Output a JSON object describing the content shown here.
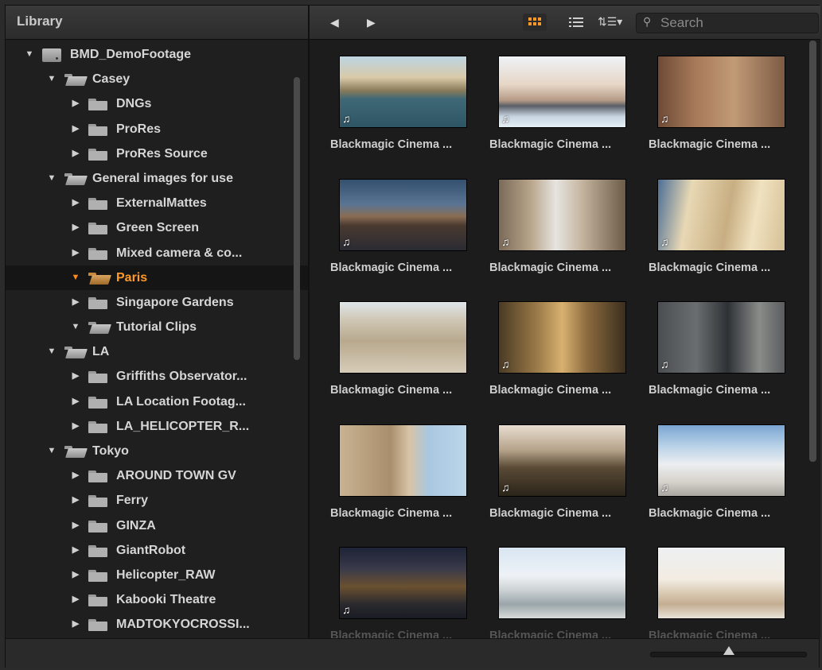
{
  "sidebar": {
    "title": "Library",
    "tree": [
      {
        "label": "BMD_DemoFootage",
        "icon": "drive-icon",
        "expanded": true,
        "level": 0
      },
      {
        "label": "Casey",
        "icon": "folder-open-icon",
        "expanded": true,
        "level": 1
      },
      {
        "label": "DNGs",
        "icon": "folder-icon",
        "expanded": false,
        "level": 2
      },
      {
        "label": "ProRes",
        "icon": "folder-icon",
        "expanded": false,
        "level": 2
      },
      {
        "label": "ProRes Source",
        "icon": "folder-icon",
        "expanded": false,
        "level": 2
      },
      {
        "label": "General images for use",
        "icon": "folder-open-icon",
        "expanded": true,
        "level": 1
      },
      {
        "label": "ExternalMattes",
        "icon": "folder-icon",
        "expanded": false,
        "level": 2
      },
      {
        "label": "Green Screen",
        "icon": "folder-icon",
        "expanded": false,
        "level": 2
      },
      {
        "label": "Mixed camera & co...",
        "icon": "folder-icon",
        "expanded": false,
        "level": 2
      },
      {
        "label": "Paris",
        "icon": "folder-open-icon",
        "expanded": true,
        "level": 2,
        "selected": true
      },
      {
        "label": "Singapore Gardens",
        "icon": "folder-icon",
        "expanded": false,
        "level": 2
      },
      {
        "label": "Tutorial Clips",
        "icon": "folder-open-icon",
        "expanded": true,
        "level": 2
      },
      {
        "label": "LA",
        "icon": "folder-open-icon",
        "expanded": true,
        "level": 1
      },
      {
        "label": "Griffiths Observator...",
        "icon": "folder-icon",
        "expanded": false,
        "level": 2
      },
      {
        "label": "LA Location Footag...",
        "icon": "folder-icon",
        "expanded": false,
        "level": 2
      },
      {
        "label": "LA_HELICOPTER_R...",
        "icon": "folder-icon",
        "expanded": false,
        "level": 2
      },
      {
        "label": "Tokyo",
        "icon": "folder-open-icon",
        "expanded": true,
        "level": 1
      },
      {
        "label": "AROUND TOWN GV",
        "icon": "folder-icon",
        "expanded": false,
        "level": 2
      },
      {
        "label": "Ferry",
        "icon": "folder-icon",
        "expanded": false,
        "level": 2
      },
      {
        "label": "GINZA",
        "icon": "folder-icon",
        "expanded": false,
        "level": 2
      },
      {
        "label": "GiantRobot",
        "icon": "folder-icon",
        "expanded": false,
        "level": 2
      },
      {
        "label": "Helicopter_RAW",
        "icon": "folder-icon",
        "expanded": false,
        "level": 2
      },
      {
        "label": "Kabooki Theatre",
        "icon": "folder-icon",
        "expanded": false,
        "level": 2
      },
      {
        "label": "MADTOKYOCROSSI...",
        "icon": "folder-icon",
        "expanded": false,
        "level": 2
      }
    ]
  },
  "toolbar": {
    "back_icon": "back-arrow-icon",
    "forward_icon": "forward-arrow-icon",
    "thumbnail_view_icon": "grid-view-icon",
    "list_view_icon": "list-view-icon",
    "sort_icon": "sort-menu-icon",
    "search_placeholder": "Search"
  },
  "clips": [
    {
      "label": "Blackmagic Cinema ...",
      "audio": true,
      "thumb": "linear-gradient(#bcd5e2 0%, #d9c9a8 30%, #8a7c5a 48%, #3f6876 60%, #2e5563 100%)"
    },
    {
      "label": "Blackmagic Cinema ...",
      "audio": true,
      "thumb": "linear-gradient(#eef2f6 0%, #e6d6c6 40%, #b59b86 62%, #5a5e66 70%, #c8d6e3 85%, #e4eef4 100%)"
    },
    {
      "label": "Blackmagic Cinema ...",
      "audio": true,
      "thumb": "linear-gradient(90deg, #6e4a36 0%, #a77a5a 30%, #c19a76 60%, #7d5a44 100%)"
    },
    {
      "label": "Blackmagic Cinema ...",
      "audio": true,
      "thumb": "linear-gradient(#34506f 0%, #5a7594 35%, #8a6c52 52%, #4a3a30 65%, #2a2b33 100%)"
    },
    {
      "label": "Blackmagic Cinema ...",
      "audio": true,
      "thumb": "linear-gradient(90deg, #7a6a58 0%, #b8a48a 25%, #e6e4e0 45%, #c6b6a0 65%, #6c5c48 100%)"
    },
    {
      "label": "Blackmagic Cinema ...",
      "audio": true,
      "thumb": "linear-gradient(100deg, #4c6f96 0%, #e8d8b4 25%, #c8ae82 55%, #f0e2c0 75%, #d6c096 100%)"
    },
    {
      "label": "Blackmagic Cinema ...",
      "audio": false,
      "thumb": "linear-gradient(#dfe6ea 0%, #cfc7b5 25%, #b8a98e 55%, #d6ccb8 100%)"
    },
    {
      "label": "Blackmagic Cinema ...",
      "audio": true,
      "thumb": "linear-gradient(90deg, #4a3a24 0%, #9a7a48 30%, #d8b070 50%, #8a6a3e 70%, #3c2e1e 100%)"
    },
    {
      "label": "Blackmagic Cinema ...",
      "audio": true,
      "thumb": "linear-gradient(90deg, #4a4e52 0%, #6a6e70 30%, #2e3236 55%, #8a8c8a 80%, #5a5c5e 100%)"
    },
    {
      "label": "Blackmagic Cinema ...",
      "audio": false,
      "thumb": "linear-gradient(90deg, #c9b292 0%, #a88e6c 40%, #d8c4a6 55%, #a9c7df 70%, #bcd6ea 100%)"
    },
    {
      "label": "Blackmagic Cinema ...",
      "audio": true,
      "thumb": "linear-gradient(#e8ddd0 0%, #b6a38a 35%, #5a4a36 60%, #2a2418 100%)"
    },
    {
      "label": "Blackmagic Cinema ...",
      "audio": true,
      "thumb": "linear-gradient(#7aa6d2 0%, #b9d2e8 30%, #eceef0 55%, #d6d2cc 80%, #a8a6a0 100%)"
    },
    {
      "label": "Blackmagic Cinema ...",
      "audio": true,
      "thumb": "linear-gradient(#1d2336 0%, #3a3a4a 30%, #6a5030 55%, #2a2a2e 80%, #1a1c24 100%)"
    },
    {
      "label": "Blackmagic Cinema ...",
      "audio": false,
      "thumb": "linear-gradient(#d8e6f2 0%, #eef2f6 40%, #cdd2d4 60%, #9aa6aa 80%, #d8dcd8 100%)"
    },
    {
      "label": "Blackmagic Cinema ...",
      "audio": false,
      "thumb": "linear-gradient(#eef0f2 0%, #f2ece2 45%, #d8c8b0 65%, #c4ae92 80%, #e8e2d8 100%)"
    }
  ],
  "zoom": {
    "value": 0.5
  },
  "colors": {
    "accent": "#ff9a2a",
    "selected_row_bg": "#151515"
  }
}
